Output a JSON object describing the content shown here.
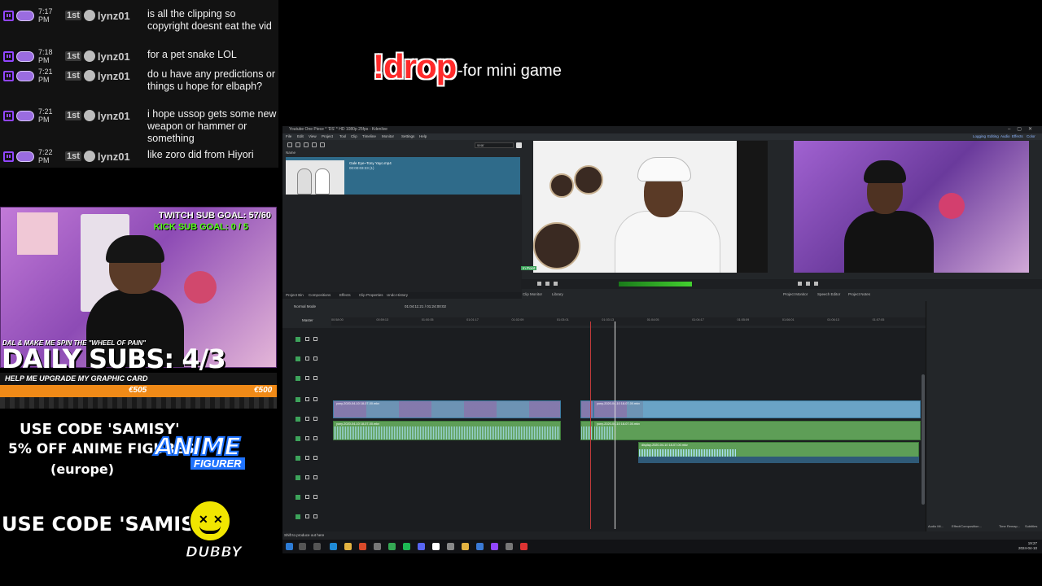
{
  "chat": {
    "messages": [
      {
        "time": "7:17 PM",
        "badge": "1st",
        "user": "lynz01",
        "text": "is all the clipping so copyright doesnt eat the vid"
      },
      {
        "time": "7:18 PM",
        "badge": "1st",
        "user": "lynz01",
        "text": "for a pet snake LOL"
      },
      {
        "time": "7:21 PM",
        "badge": "1st",
        "user": "lynz01",
        "text": "do u have any predictions or things u hope for elbaph?"
      },
      {
        "time": "7:21 PM",
        "badge": "1st",
        "user": "lynz01",
        "text": "i hope ussop gets some new weapon or hammer or something"
      },
      {
        "time": "7:22 PM",
        "badge": "1st",
        "user": "lynz01",
        "text": "like zoro did from Hiyori"
      }
    ]
  },
  "drop": {
    "command": "!drop",
    "description": "-for mini game"
  },
  "cam": {
    "twitch_goal": "TWITCH SUB GOAL: 57/60",
    "kick_goal": "KICK SUB GOAL: 0 / 5",
    "caption": "DAL & MAKE ME SPIN THE \"WHEEL OF PAIN\""
  },
  "daily_subs": "DAILY SUBS: 4/3",
  "graphics_goal": {
    "label": "HELP ME UPGRADE MY GRAPHIC CARD",
    "current": "€505",
    "target": "€500",
    "progress": 1.0,
    "color": "#f08a17"
  },
  "promos": {
    "line1": "USE CODE 'SAMISY'",
    "line2": "5% OFF ANIME FIGURES",
    "line3": "(europe)",
    "anime_logo_main": "ANIME",
    "anime_logo_sub": "FIGURER",
    "line4": "USE CODE 'SAMISY'",
    "dubby_label": "DUBBY"
  },
  "editor": {
    "window_title": "Youtube One Piece * 'DS' * HD 1080p 25fps - Kdenlive",
    "menus": [
      "File",
      "Edit",
      "View",
      "Project",
      "Tool",
      "Clip",
      "Timeline",
      "Monitor",
      "Settings",
      "Help"
    ],
    "workspaces": [
      "Logging",
      "Editing",
      "Audio",
      "Effects",
      "Color"
    ],
    "bin_search": "sear",
    "bin_header": "Name",
    "bin_clip_name": "Gale Eye~Tony Yayo.mp4",
    "bin_clip_duration": "00:00:03:23 (1)",
    "clip_tag": "In Point",
    "bin_tabs": [
      "Project Bin",
      "Compositions",
      "Effects",
      "Clip Properties",
      "Undo History"
    ],
    "monitor_tabs": [
      "Clip Monitor",
      "Library",
      "Project Monitor",
      "Speech Editor",
      "Project Notes"
    ],
    "edit_mode": "Normal Mode",
    "timecode": "01:04:11:21 / 01:24:00:02",
    "master_label": "Master",
    "ruler_labels": [
      "00:58:00",
      "00:59:13",
      "01:00:05",
      "01:01:17",
      "01:02:09",
      "01:03:01",
      "01:03:13",
      "01:04:05",
      "01:04:17",
      "01:05:09",
      "01:06:01",
      "01:06:13",
      "01:07:05"
    ],
    "video_clip_label": "yuny-2020-04-10 18-07-00.mkv",
    "audio_clip_label": "yuny-2020-04-10 18-07-00.mkv",
    "second_audio_label": "display-2020-04-10 18-07-00.mkv",
    "bottom_tabs": [
      "Audio Mi...",
      "Effect/Composition...",
      "Time Remap...",
      "Subtitles"
    ],
    "status_text": "Shift to produce out here",
    "clock_time": "19:27",
    "clock_date": "2024-04-10"
  },
  "colors": {
    "twitch_purple": "#9146ff",
    "kick_green": "#53fc18",
    "drop_red": "#ff2a2a",
    "video_clip": "#6aa3c6",
    "audio_clip": "#5e9e57"
  }
}
